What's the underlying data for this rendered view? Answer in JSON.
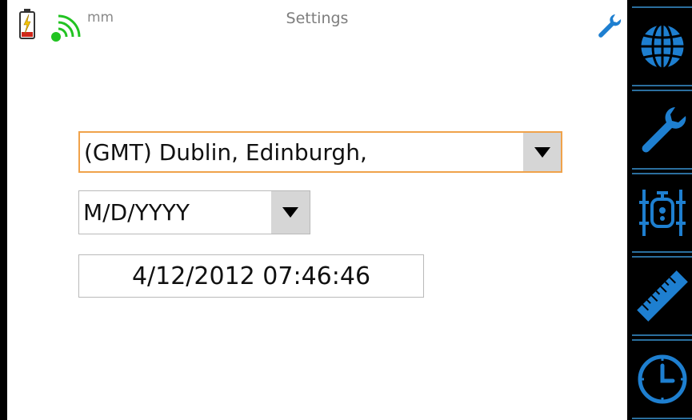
{
  "status_bar": {
    "unit": "mm",
    "title": "Settings",
    "battery_icon": "battery-charging-icon",
    "signal_icon": "wifi-signal-icon",
    "settings_icon": "wrench-icon"
  },
  "form": {
    "timezone": {
      "value": "(GMT) Dublin, Edinburgh,"
    },
    "date_format": {
      "value": "M/D/YYYY"
    },
    "datetime": {
      "value": "4/12/2012 07:46:46"
    }
  },
  "side_nav": {
    "items": [
      {
        "icon": "globe-icon"
      },
      {
        "icon": "wrench-icon"
      },
      {
        "icon": "machine-icon"
      },
      {
        "icon": "ruler-icon"
      },
      {
        "icon": "clock-icon"
      }
    ]
  },
  "colors": {
    "accent": "#1e7fd0",
    "focus_border": "#f0a24a",
    "battery_red": "#d0281b",
    "signal_green": "#22c322"
  }
}
